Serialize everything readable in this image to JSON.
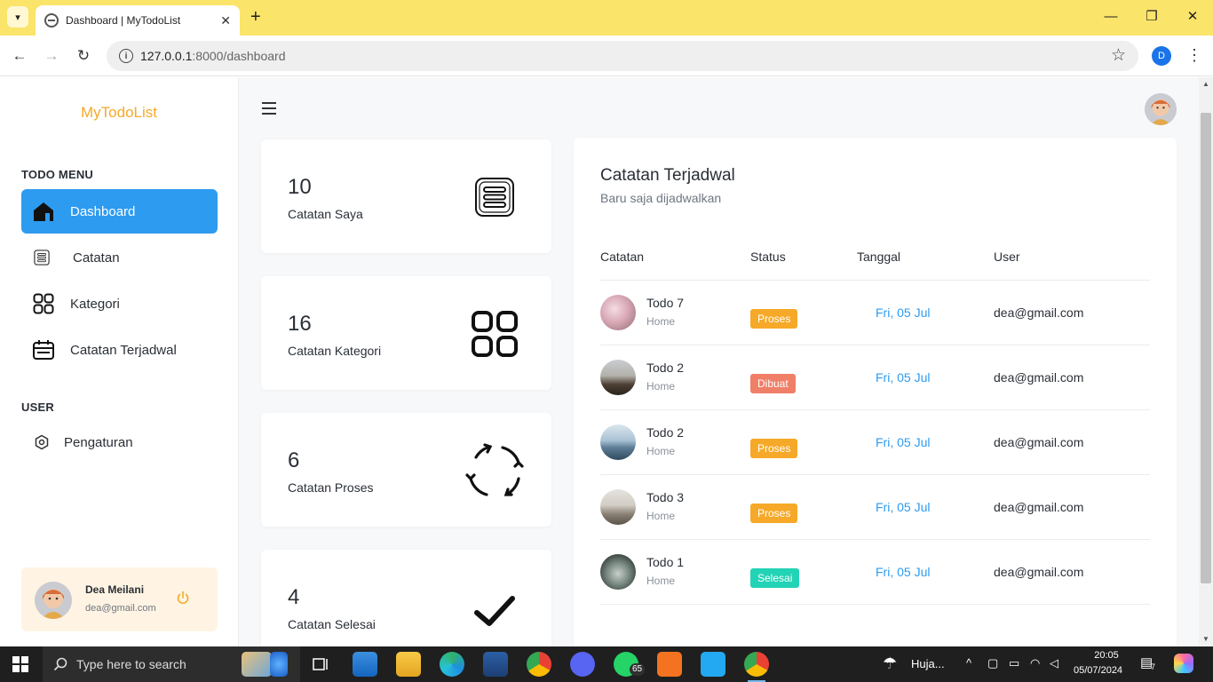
{
  "browser": {
    "tab_title": "Dashboard | MyTodoList",
    "tab_close": "✕",
    "new_tab": "+",
    "url_host": "127.0.0.1",
    "url_path": ":8000/dashboard",
    "profile_initial": "D",
    "window_controls": {
      "minimize": "—",
      "maximize": "❐",
      "close": "✕"
    },
    "nav": {
      "back": "←",
      "forward": "→",
      "reload": "↻"
    }
  },
  "sidebar": {
    "brand": "MyTodoList",
    "todo_heading": "TODO MENU",
    "todo_items": [
      {
        "label": "Dashboard",
        "icon": "home-icon",
        "active": true
      },
      {
        "label": "Catatan",
        "icon": "notes-list-icon",
        "active": false
      },
      {
        "label": "Kategori",
        "icon": "category-grid-icon",
        "active": false
      },
      {
        "label": "Catatan Terjadwal",
        "icon": "calendar-icon",
        "active": false
      }
    ],
    "user_heading": "USER",
    "user_items": [
      {
        "label": "Pengaturan",
        "icon": "settings-icon"
      }
    ],
    "user_card": {
      "name": "Dea Meilani",
      "email": "dea@gmail.com"
    }
  },
  "stats": [
    {
      "value": "10",
      "label": "Catatan Saya",
      "icon": "notes-list-icon"
    },
    {
      "value": "16",
      "label": "Catatan Kategori",
      "icon": "category-grid-icon"
    },
    {
      "value": "6",
      "label": "Catatan Proses",
      "icon": "sync-arrows-icon"
    },
    {
      "value": "4",
      "label": "Catatan Selesai",
      "icon": "checkmark-icon"
    }
  ],
  "schedule": {
    "title": "Catatan Terjadwal",
    "subtitle": "Baru saja dijadwalkan",
    "columns": [
      "Catatan",
      "Status",
      "Tanggal",
      "User"
    ],
    "rows": [
      {
        "name": "Todo 7",
        "category": "Home",
        "status": "Proses",
        "date": "Fri, 05 Jul",
        "user": "dea@gmail.com"
      },
      {
        "name": "Todo 2",
        "category": "Home",
        "status": "Dibuat",
        "date": "Fri, 05 Jul",
        "user": "dea@gmail.com"
      },
      {
        "name": "Todo 2",
        "category": "Home",
        "status": "Proses",
        "date": "Fri, 05 Jul",
        "user": "dea@gmail.com"
      },
      {
        "name": "Todo 3",
        "category": "Home",
        "status": "Proses",
        "date": "Fri, 05 Jul",
        "user": "dea@gmail.com"
      },
      {
        "name": "Todo 1",
        "category": "Home",
        "status": "Selesai",
        "date": "Fri, 05 Jul",
        "user": "dea@gmail.com"
      }
    ]
  },
  "colors": {
    "accent": "#2d9bf0",
    "brand": "#f6a928",
    "status_proses": "#f6a928",
    "status_dibuat": "#f07f67",
    "status_selesai": "#22d3b5",
    "tabbar": "#fbe46a"
  },
  "taskbar": {
    "search_placeholder": "Type here to search",
    "whatsapp_badge": "65",
    "weather": "Huja...",
    "time": "20:05",
    "date": "05/07/2024",
    "notifications": "7"
  }
}
